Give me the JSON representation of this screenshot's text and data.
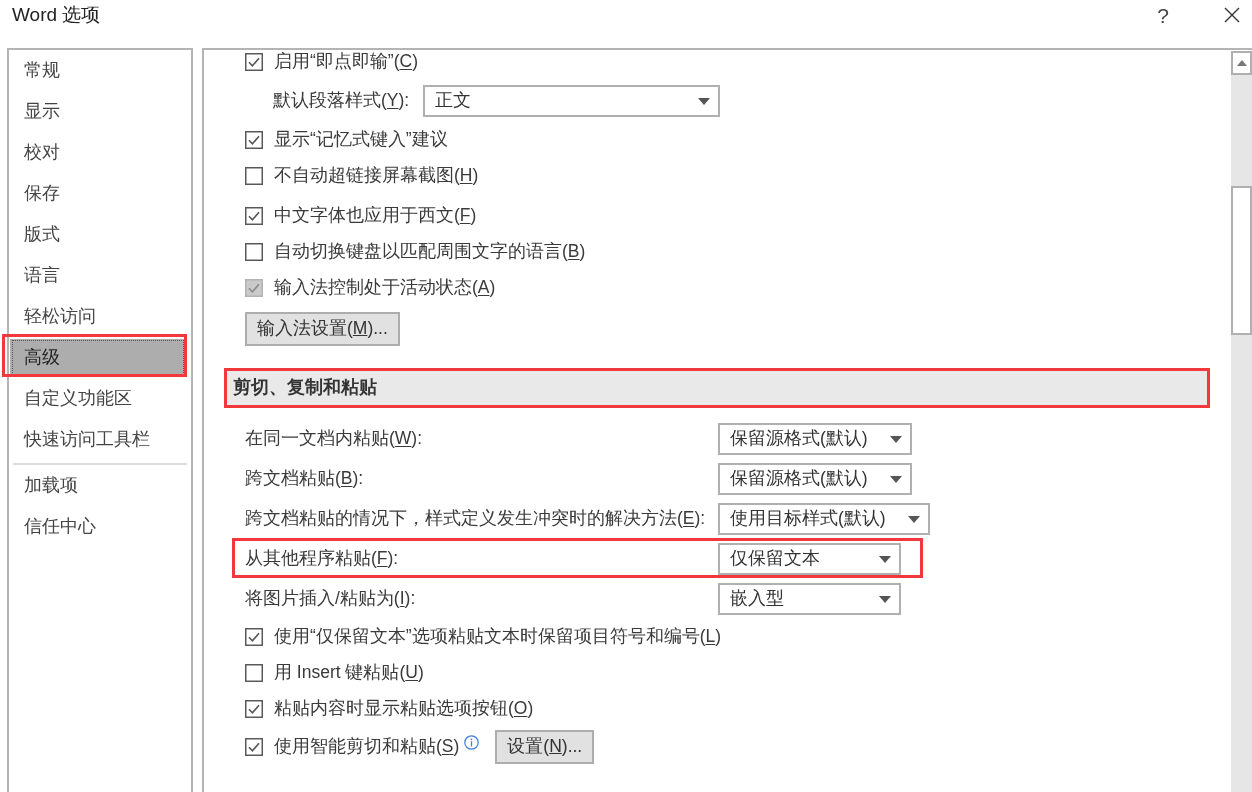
{
  "window": {
    "title": "Word 选项",
    "help": "?"
  },
  "sidebar": {
    "groups": [
      {
        "items": [
          {
            "label": "常规",
            "selected": false,
            "highlighted": false
          },
          {
            "label": "显示",
            "selected": false,
            "highlighted": false
          },
          {
            "label": "校对",
            "selected": false,
            "highlighted": false
          },
          {
            "label": "保存",
            "selected": false,
            "highlighted": false
          },
          {
            "label": "版式",
            "selected": false,
            "highlighted": false
          },
          {
            "label": "语言",
            "selected": false,
            "highlighted": false
          },
          {
            "label": "轻松访问",
            "selected": false,
            "highlighted": false
          },
          {
            "label": "高级",
            "selected": true,
            "highlighted": true
          },
          {
            "label": "自定义功能区",
            "selected": false,
            "highlighted": false
          },
          {
            "label": "快速访问工具栏",
            "selected": false,
            "highlighted": false
          }
        ]
      },
      {
        "items": [
          {
            "label": "加载项",
            "selected": false,
            "highlighted": false
          },
          {
            "label": "信任中心",
            "selected": false,
            "highlighted": false
          }
        ]
      }
    ]
  },
  "options": {
    "groups": [
      {
        "rows": [
          {
            "kind": "checkbox",
            "label": "启用“即点即输”(C)",
            "checked": true,
            "disabled": false
          },
          {
            "kind": "dropdown",
            "label": "默认段落样式(Y):",
            "value": "正文"
          },
          {
            "kind": "checkbox",
            "label": "显示“记忆式键入”建议",
            "checked": true,
            "disabled": false
          },
          {
            "kind": "checkbox",
            "label": "不自动超链接屏幕截图(H)",
            "checked": false,
            "disabled": false
          }
        ]
      },
      {
        "rows": [
          {
            "kind": "checkbox",
            "label": "中文字体也应用于西文(F)",
            "checked": true,
            "disabled": false
          },
          {
            "kind": "checkbox",
            "label": "自动切换键盘以匹配周围文字的语言(B)",
            "checked": false,
            "disabled": false
          },
          {
            "kind": "checkbox",
            "label": "输入法控制处于活动状态(A)",
            "checked": true,
            "disabled": true
          },
          {
            "kind": "button",
            "label": "输入法设置(M)..."
          }
        ]
      }
    ],
    "sections": [
      {
        "title": "剪切、复制和粘贴",
        "highlighted": true,
        "rows": [
          {
            "kind": "dropdown",
            "label": "在同一文档内粘贴(W):",
            "value": "保留源格式(默认)",
            "highlighted": false
          },
          {
            "kind": "dropdown",
            "label": "跨文档粘贴(B):",
            "value": "保留源格式(默认)",
            "highlighted": false
          },
          {
            "kind": "dropdown",
            "label": "跨文档粘贴的情况下，样式定义发生冲突时的解决方法(E):",
            "value": "使用目标样式(默认)",
            "highlighted": false
          },
          {
            "kind": "dropdown",
            "label": "从其他程序粘贴(F):",
            "value": "仅保留文本",
            "highlighted": true
          },
          {
            "kind": "dropdown",
            "label": "将图片插入/粘贴为(I):",
            "value": "嵌入型",
            "highlighted": false
          },
          {
            "kind": "checkbox",
            "label": "使用“仅保留文本”选项粘贴文本时保留项目符号和编号(L)",
            "checked": true,
            "disabled": false,
            "highlighted": false
          },
          {
            "kind": "checkbox",
            "label": "用 Insert 键粘贴(U)",
            "checked": false,
            "disabled": false,
            "highlighted": false
          },
          {
            "kind": "checkbox",
            "label": "粘贴内容时显示粘贴选项按钮(O)",
            "checked": true,
            "disabled": false,
            "highlighted": false
          },
          {
            "kind": "checkbox_info_button",
            "label": "使用智能剪切和粘贴(S)",
            "checked": true,
            "disabled": false,
            "button": "设置(N)...",
            "highlighted": false
          }
        ]
      }
    ]
  }
}
